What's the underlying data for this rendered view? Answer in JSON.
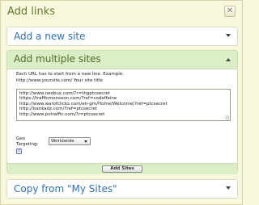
{
  "dialog": {
    "title": "Add links",
    "close_label": "✕"
  },
  "sections": {
    "add_new": {
      "label": "Add a new site",
      "expanded": false
    },
    "add_multiple": {
      "label": "Add multiple sites",
      "expanded": true,
      "instructions_line1": "Each URL has to start from a new line. Example:",
      "instructions_line2": "http://www.yoursite.com/ Your site title",
      "urls": [
        "http://www.neobux.com/?r=thgptcsecret",
        "https://trafficmonsoon.com/?ref=codeffeine",
        "http://www.warofclicks.com/en-gm/Home/Welcome/?ref=ptcsecret",
        "http://bankadz.com/?ref=ptcsecret",
        "http://www.pvtraffic.com/?r=ptcsecret"
      ],
      "geo_label": "Geo Targeting:",
      "geo_value": "Worldwide",
      "help_label": "?",
      "submit_label": "Add Sites"
    },
    "copy_from": {
      "label": "Copy from \"My Sites\"",
      "expanded": false
    }
  },
  "colors": {
    "background": "#faf8dc",
    "title": "#5d7d2c",
    "section_link": "#2f6fb5",
    "panel_header": "#dbeec8"
  }
}
